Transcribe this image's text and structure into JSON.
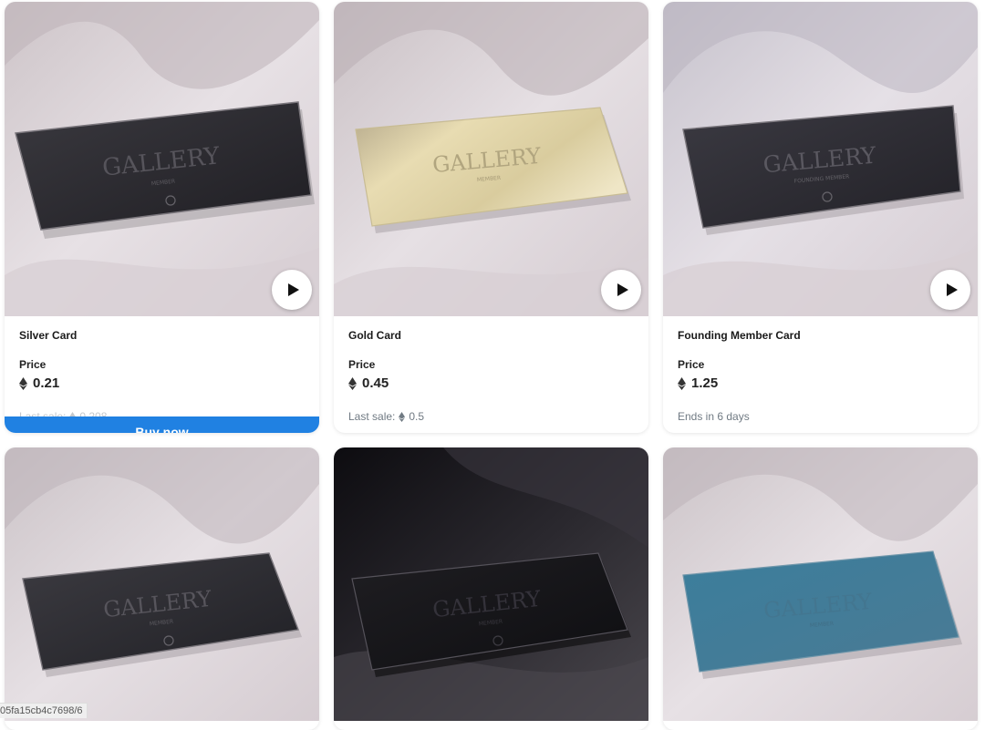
{
  "colors": {
    "accent": "#2081e2",
    "fabric_light": "#e4dee2",
    "fabric_dark": "#18161a"
  },
  "cards": [
    {
      "name": "Silver Card",
      "price_label": "Price",
      "price": "0.21",
      "meta_prefix": "Last sale:",
      "meta_value": "0.208",
      "button": "Buy now",
      "icons": [
        "play-icon",
        "eth-icon"
      ],
      "card_color": "black",
      "card_text": "GALLERY",
      "card_sub": "MEMBER"
    },
    {
      "name": "Gold Card",
      "price_label": "Price",
      "price": "0.45",
      "meta_prefix": "Last sale:",
      "meta_value": "0.5",
      "icons": [
        "play-icon",
        "eth-icon"
      ],
      "card_color": "gold",
      "card_text": "GALLERY",
      "card_sub": "MEMBER"
    },
    {
      "name": "Founding Member Card",
      "price_label": "Price",
      "price": "1.25",
      "meta_prefix": "Ends in 6 days",
      "icons": [
        "play-icon",
        "eth-icon"
      ],
      "card_color": "black",
      "card_text": "GALLERY",
      "card_sub": "FOUNDING MEMBER"
    },
    {
      "card_color": "black",
      "card_text": "GALLERY",
      "card_sub": "MEMBER"
    },
    {
      "card_color": "black",
      "card_text": "GALLERY",
      "card_sub": "MEMBER"
    },
    {
      "card_color": "blue",
      "card_text": "GALLERY",
      "card_sub": "MEMBER"
    }
  ],
  "status_bar": {
    "text": "05fa15cb4c7698/6"
  }
}
